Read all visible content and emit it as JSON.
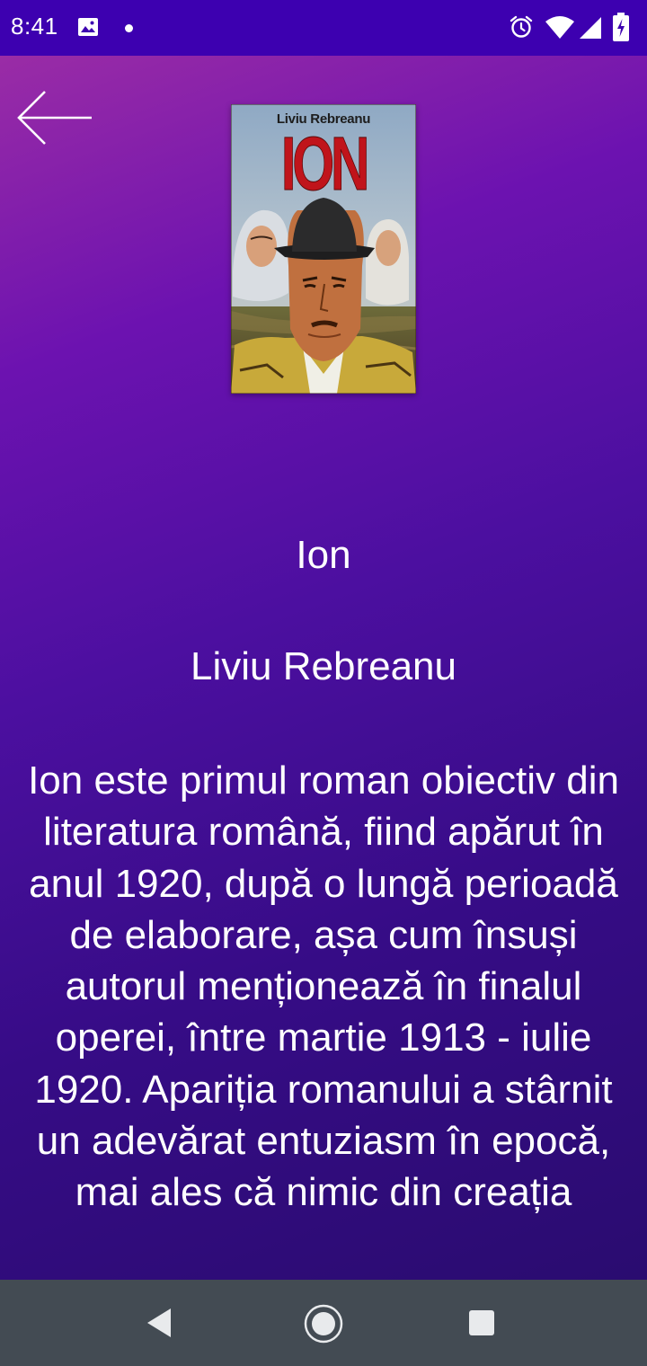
{
  "status_bar": {
    "time": "8:41",
    "icons": [
      "photo-icon",
      "notification-dot-icon",
      "alarm-icon",
      "wifi-icon",
      "signal-icon",
      "battery-charging-icon"
    ]
  },
  "toolbar": {
    "back_icon": "arrow-left-icon"
  },
  "book": {
    "cover": {
      "author": "Liviu Rebreanu",
      "title": "ION"
    },
    "title": "Ion",
    "author": "Liviu Rebreanu",
    "description": "Ion este primul roman obiectiv din literatura română, fiind apărut în anul 1920, după o lungă perioadă de elaborare, așa cum însuși autorul menționează în finalul operei, între martie 1913 - iulie 1920. Apariția romanului a stârnit un adevărat entuziasm în epocă, mai ales că nimic din creația"
  },
  "nav_bar": {
    "icons": [
      "nav-back-icon",
      "nav-home-icon",
      "nav-recents-icon"
    ]
  },
  "colors": {
    "status_bar": "#3d00b0",
    "gradient_top": "#9a2ca6",
    "gradient_bottom": "#2a0c70",
    "nav_bar": "#434b53",
    "text": "#ffffff",
    "cover_title": "#c0141b"
  }
}
